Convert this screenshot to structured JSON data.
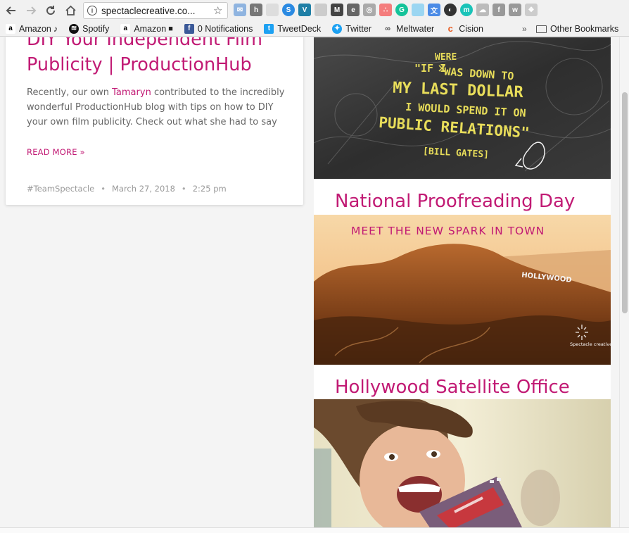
{
  "browser": {
    "url": "spectaclecreative.co...",
    "bookmarks": [
      {
        "label": "Amazon",
        "icon": "amazon-music-icon",
        "suffix": "♪"
      },
      {
        "label": "Spotify",
        "icon": "spotify-icon"
      },
      {
        "label": "Amazon",
        "icon": "amazon-video-icon",
        "suffix": "🎬"
      },
      {
        "label": "0 Notifications",
        "icon": "facebook-icon"
      },
      {
        "label": "TweetDeck",
        "icon": "tweetdeck-icon"
      },
      {
        "label": "Twitter",
        "icon": "twitter-icon"
      },
      {
        "label": "Meltwater",
        "icon": "meltwater-icon"
      },
      {
        "label": "Cision",
        "icon": "cision-icon"
      }
    ],
    "more": "»",
    "other_bookmarks": "Other Bookmarks"
  },
  "left_post": {
    "title": "DIY Your Independent Film Publicity | ProductionHub",
    "excerpt_before": "Recently, our own ",
    "excerpt_link": "Tamaryn",
    "excerpt_after": " contributed to the incredibly wonderful ProductionHub blog with tips on how to DIY your own film publicity. Check out what she had to say",
    "read_more": "READ MORE »",
    "tag": "#TeamSpectacle",
    "date": "March 27, 2018",
    "time": "2:25 pm",
    "separator": "•"
  },
  "right_posts": [
    {
      "image_quote_top": "\"IF I",
      "image_quote_were": "WERE",
      "image_quote_was": "WAS DOWN TO",
      "image_quote_line2": "MY LAST DOLLAR",
      "image_quote_line3": "I WOULD SPEND IT ON",
      "image_quote_line4": "PUBLIC RELATIONS\"",
      "image_quote_author": "[BILL GATES]"
    },
    {
      "title": "National Proofreading Day",
      "image_banner": "MEET THE NEW SPARK IN TOWN",
      "image_sign": "HOLLYWOOD",
      "image_logo": "Spectacle creative media"
    },
    {
      "title": "Hollywood Satellite Office"
    }
  ],
  "colors": {
    "accent": "#c11a74",
    "quote_yellow": "#e8dd5a"
  }
}
